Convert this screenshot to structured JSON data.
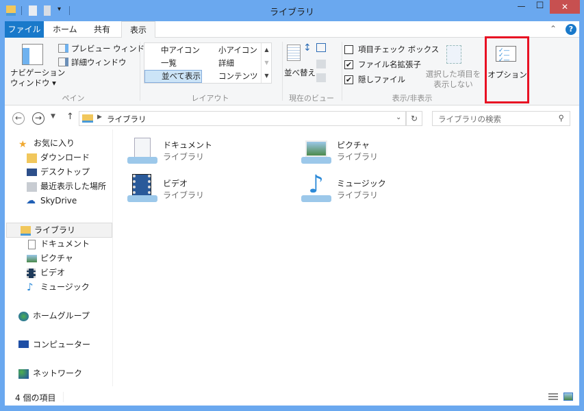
{
  "window": {
    "title": "ライブラリ",
    "minimize": "—",
    "maximize": "☐",
    "close": "✕"
  },
  "tabs": [
    {
      "label": "ファイル"
    },
    {
      "label": "ホーム"
    },
    {
      "label": "共有"
    },
    {
      "label": "表示"
    }
  ],
  "ribbon": {
    "pane": {
      "nav_pane": "ナビゲーション",
      "nav_pane2": "ウィンドウ ▾",
      "preview": "プレビュー ウィンドウ",
      "details": "詳細ウィンドウ",
      "label": "ペイン"
    },
    "layout": {
      "items": [
        "中アイコン",
        "小アイコン",
        "一覧",
        "詳細",
        "並べて表示",
        "コンテンツ"
      ],
      "selected": "並べて表示",
      "label": "レイアウト"
    },
    "current_view": {
      "sort": "並べ替え",
      "label": "現在のビュー"
    },
    "show_hide": {
      "item_checkbox": "項目チェック ボックス",
      "item_checkbox_checked": false,
      "extensions": "ファイル名拡張子",
      "extensions_checked": true,
      "hidden": "隠しファイル",
      "hidden_checked": true,
      "hide_selected": "選択した項目を",
      "hide_selected2": "表示しない",
      "label": "表示/非表示"
    },
    "options": {
      "label": "オプション",
      "highlight_color": "#e81123"
    }
  },
  "address": {
    "path": "ライブラリ",
    "search_placeholder": "ライブラリの検索"
  },
  "nav": {
    "favorites": "お気に入り",
    "favorites_items": [
      "ダウンロード",
      "デスクトップ",
      "最近表示した場所",
      "SkyDrive"
    ],
    "libraries": "ライブラリ",
    "library_items": [
      "ドキュメント",
      "ピクチャ",
      "ビデオ",
      "ミュージック"
    ],
    "homegroup": "ホームグループ",
    "computer": "コンピューター",
    "network": "ネットワーク"
  },
  "content": [
    {
      "name": "ドキュメント",
      "type": "ライブラリ"
    },
    {
      "name": "ピクチャ",
      "type": "ライブラリ"
    },
    {
      "name": "ビデオ",
      "type": "ライブラリ"
    },
    {
      "name": "ミュージック",
      "type": "ライブラリ"
    }
  ],
  "status": {
    "count": "4 個の項目"
  },
  "colors": {
    "titlebar": "#6aa8ef",
    "file_tab": "#1979ca",
    "close": "#c75050"
  }
}
